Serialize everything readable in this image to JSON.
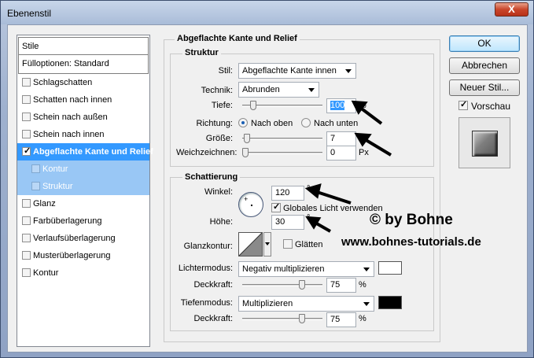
{
  "window": {
    "title": "Ebenenstil",
    "close_glyph": "X"
  },
  "style_list": {
    "header": "Stile",
    "blend_options": "Fülloptionen: Standard",
    "items": [
      {
        "label": "Schlagschatten",
        "checked": false
      },
      {
        "label": "Schatten nach innen",
        "checked": false
      },
      {
        "label": "Schein nach außen",
        "checked": false
      },
      {
        "label": "Schein nach innen",
        "checked": false
      },
      {
        "label": "Abgeflachte Kante und Relief",
        "checked": true
      },
      {
        "label": "Kontur",
        "checked": false
      },
      {
        "label": "Struktur",
        "checked": false
      },
      {
        "label": "Glanz",
        "checked": false
      },
      {
        "label": "Farbüberlagerung",
        "checked": false
      },
      {
        "label": "Verlaufsüberlagerung",
        "checked": false
      },
      {
        "label": "Musterüberlagerung",
        "checked": false
      },
      {
        "label": "Kontur",
        "checked": false
      }
    ]
  },
  "bevel": {
    "title": "Abgeflachte Kante und Relief",
    "structure": {
      "title": "Struktur",
      "style_label": "Stil:",
      "style_value": "Abgeflachte Kante innen",
      "technique_label": "Technik:",
      "technique_value": "Abrunden",
      "depth_label": "Tiefe:",
      "depth_value": "100",
      "depth_unit": "%",
      "direction_label": "Richtung:",
      "direction_up": "Nach oben",
      "direction_down": "Nach unten",
      "size_label": "Größe:",
      "size_value": "7",
      "size_unit": "Px",
      "soften_label": "Weichzeichnen:",
      "soften_value": "0",
      "soften_unit": "Px"
    },
    "shading": {
      "title": "Schattierung",
      "angle_label": "Winkel:",
      "angle_value": "120",
      "angle_unit": "°",
      "global_light_label": "Globales Licht verwenden",
      "global_light_checked": true,
      "altitude_label": "Höhe:",
      "altitude_value": "30",
      "altitude_unit": "°",
      "gloss_label": "Glanzkontur:",
      "antialias_label": "Glätten",
      "highlight_mode_label": "Lichtermodus:",
      "highlight_mode_value": "Negativ multiplizieren",
      "highlight_color": "#ffffff",
      "highlight_opacity_label": "Deckkraft:",
      "highlight_opacity_value": "75",
      "highlight_opacity_unit": "%",
      "shadow_mode_label": "Tiefenmodus:",
      "shadow_mode_value": "Multiplizieren",
      "shadow_color": "#000000",
      "shadow_opacity_label": "Deckkraft:",
      "shadow_opacity_value": "75",
      "shadow_opacity_unit": "%"
    }
  },
  "buttons": {
    "ok": "OK",
    "cancel": "Abbrechen",
    "new_style": "Neuer Stil...",
    "preview_label": "Vorschau",
    "preview_checked": true
  },
  "watermark": {
    "line1": "© by Bohne",
    "line2": "www.bohnes-tutorials.de"
  },
  "colors": {
    "selection": "#3399ff",
    "sub_selection": "#99c7f5",
    "annotation_arrow": "#000000"
  }
}
